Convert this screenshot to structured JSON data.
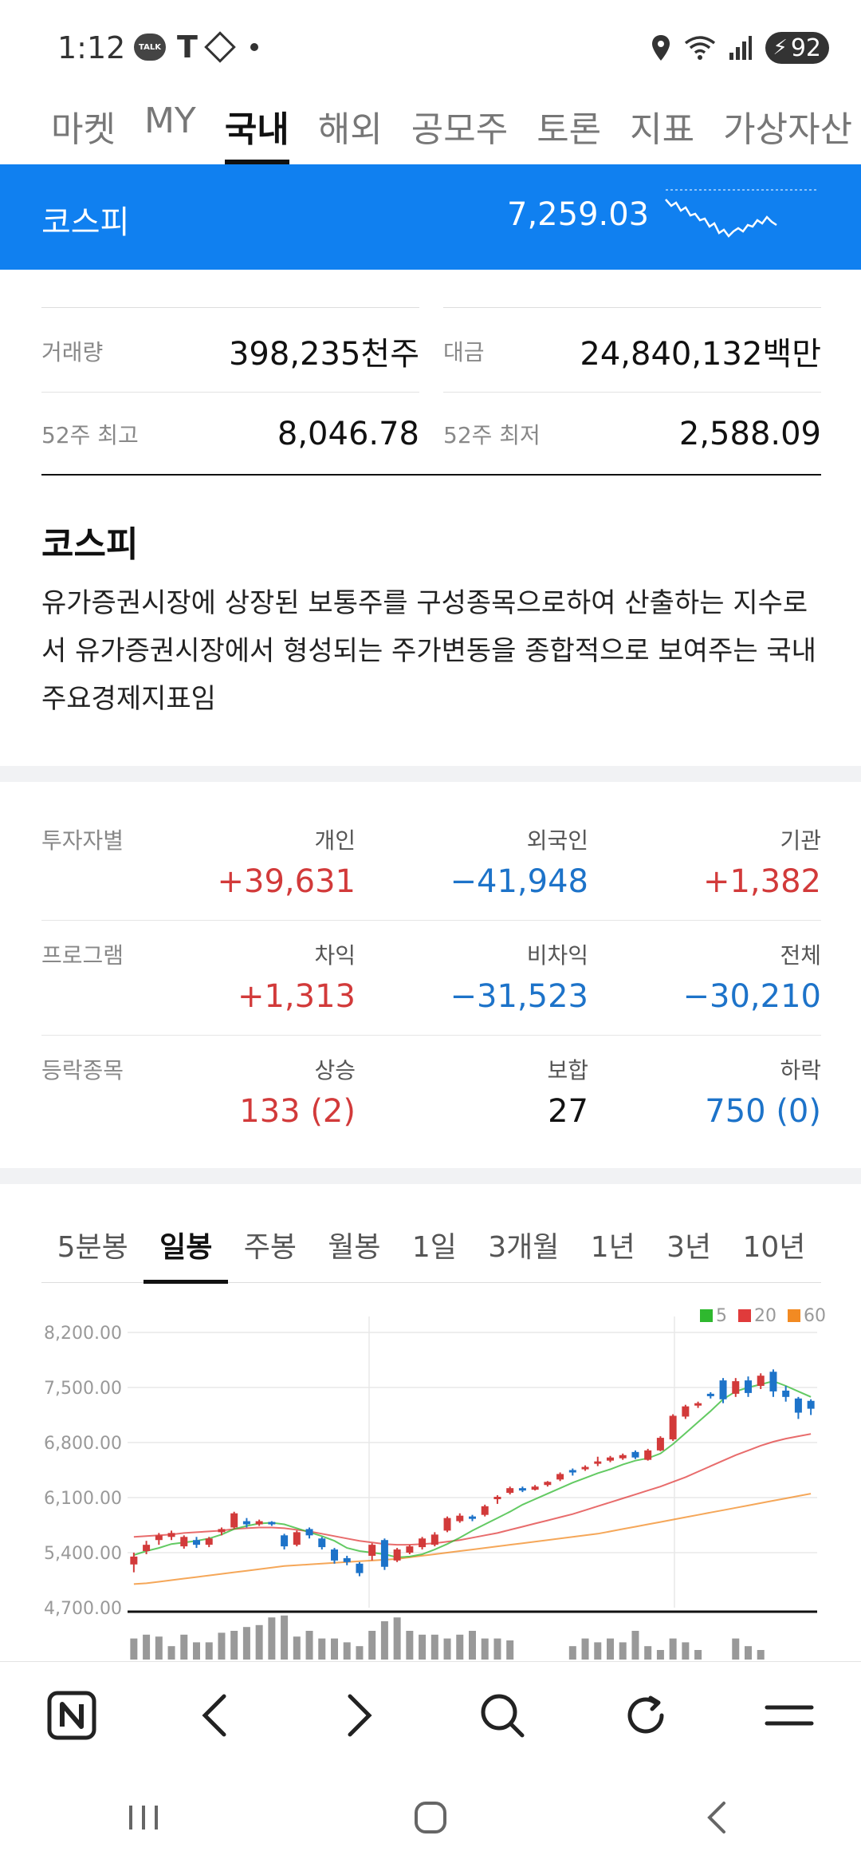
{
  "status_bar": {
    "time": "1:12",
    "battery": "92",
    "icons": [
      "kakaotalk-icon",
      "t-icon",
      "diamond-icon",
      "dot-icon",
      "location-icon",
      "wifi-icon",
      "signal-icon",
      "battery-icon"
    ]
  },
  "top_tabs": [
    {
      "label": "마켓",
      "active": false
    },
    {
      "label": "MY",
      "active": false
    },
    {
      "label": "국내",
      "active": true
    },
    {
      "label": "해외",
      "active": false
    },
    {
      "label": "공모주",
      "active": false
    },
    {
      "label": "토론",
      "active": false
    },
    {
      "label": "지표",
      "active": false
    },
    {
      "label": "가상자산",
      "active": false
    }
  ],
  "banner": {
    "name": "코스피",
    "value": "7,259.03",
    "color": "#1080f0"
  },
  "stats": {
    "volume_label": "거래량",
    "volume_value": "398,235천주",
    "amount_label": "대금",
    "amount_value": "24,840,132백만",
    "high52_label": "52주 최고",
    "high52_value": "8,046.78",
    "low52_label": "52주 최저",
    "low52_value": "2,588.09"
  },
  "description": {
    "title": "코스피",
    "text": "유가증권시장에 상장된 보통주를 구성종목으로하여 산출하는 지수로서 유가증권시장에서 형성되는 주가변동을 종합적으로 보여주는 국내 주요경제지표임"
  },
  "investors": {
    "label": "투자자별",
    "col1": {
      "header": "개인",
      "value": "+39,631"
    },
    "col2": {
      "header": "외국인",
      "value": "−41,948"
    },
    "col3": {
      "header": "기관",
      "value": "+1,382"
    }
  },
  "program": {
    "label": "프로그램",
    "col1": {
      "header": "차익",
      "value": "+1,313"
    },
    "col2": {
      "header": "비차익",
      "value": "−31,523"
    },
    "col3": {
      "header": "전체",
      "value": "−30,210"
    }
  },
  "breadth": {
    "label": "등락종목",
    "col1": {
      "header": "상승",
      "value": "133 (2)"
    },
    "col2": {
      "header": "보합",
      "value": "27"
    },
    "col3": {
      "header": "하락",
      "value": "750 (0)"
    }
  },
  "period_tabs": [
    {
      "label": "5분봉",
      "active": false
    },
    {
      "label": "일봉",
      "active": true
    },
    {
      "label": "주봉",
      "active": false
    },
    {
      "label": "월봉",
      "active": false
    },
    {
      "label": "1일",
      "active": false
    },
    {
      "label": "3개월",
      "active": false
    },
    {
      "label": "1년",
      "active": false
    },
    {
      "label": "3년",
      "active": false
    },
    {
      "label": "10년",
      "active": false
    }
  ],
  "colors": {
    "up": "#d23a3a",
    "down": "#1d73c9",
    "ma5": "#2fb82f",
    "ma20": "#e03b3b",
    "ma60": "#f28a22"
  },
  "chart_data": {
    "type": "candlestick",
    "y_ticks": [
      "8,200.00",
      "7,500.00",
      "6,800.00",
      "6,100.00",
      "5,400.00",
      "4,700.00"
    ],
    "ylim": [
      4700,
      8200
    ],
    "legend": [
      {
        "name": "5",
        "color": "#2fb82f"
      },
      {
        "name": "20",
        "color": "#e03b3b"
      },
      {
        "name": "60",
        "color": "#f28a22"
      }
    ],
    "candles": [
      [
        5250,
        5350,
        5150,
        5400
      ],
      [
        5420,
        5500,
        5380,
        5550
      ],
      [
        5560,
        5620,
        5500,
        5650
      ],
      [
        5600,
        5650,
        5560,
        5680
      ],
      [
        5480,
        5600,
        5450,
        5620
      ],
      [
        5560,
        5500,
        5460,
        5600
      ],
      [
        5500,
        5580,
        5470,
        5600
      ],
      [
        5660,
        5700,
        5620,
        5720
      ],
      [
        5720,
        5900,
        5700,
        5920
      ],
      [
        5800,
        5760,
        5720,
        5840
      ],
      [
        5760,
        5800,
        5740,
        5820
      ],
      [
        5790,
        5770,
        5740,
        5800
      ],
      [
        5620,
        5480,
        5440,
        5640
      ],
      [
        5500,
        5660,
        5480,
        5680
      ],
      [
        5700,
        5620,
        5580,
        5720
      ],
      [
        5580,
        5470,
        5440,
        5600
      ],
      [
        5440,
        5300,
        5260,
        5460
      ],
      [
        5330,
        5280,
        5240,
        5360
      ],
      [
        5260,
        5140,
        5100,
        5280
      ],
      [
        5360,
        5500,
        5300,
        5520
      ],
      [
        5560,
        5220,
        5180,
        5580
      ],
      [
        5300,
        5440,
        5280,
        5460
      ],
      [
        5400,
        5480,
        5380,
        5500
      ],
      [
        5470,
        5580,
        5440,
        5600
      ],
      [
        5500,
        5630,
        5480,
        5660
      ],
      [
        5680,
        5840,
        5660,
        5860
      ],
      [
        5800,
        5870,
        5780,
        5900
      ],
      [
        5860,
        5830,
        5800,
        5880
      ],
      [
        5880,
        5990,
        5860,
        6010
      ],
      [
        6080,
        6110,
        6020,
        6130
      ],
      [
        6160,
        6220,
        6140,
        6240
      ],
      [
        6220,
        6200,
        6170,
        6240
      ],
      [
        6200,
        6240,
        6190,
        6260
      ],
      [
        6260,
        6300,
        6240,
        6310
      ],
      [
        6330,
        6400,
        6310,
        6420
      ],
      [
        6450,
        6420,
        6380,
        6470
      ],
      [
        6480,
        6490,
        6440,
        6510
      ],
      [
        6560,
        6560,
        6500,
        6620
      ],
      [
        6570,
        6610,
        6550,
        6630
      ],
      [
        6600,
        6640,
        6580,
        6660
      ],
      [
        6680,
        6610,
        6590,
        6700
      ],
      [
        6580,
        6700,
        6570,
        6720
      ],
      [
        6700,
        6860,
        6690,
        6880
      ],
      [
        6840,
        7140,
        6820,
        7160
      ],
      [
        7130,
        7260,
        7100,
        7280
      ],
      [
        7280,
        7300,
        7240,
        7320
      ],
      [
        7420,
        7400,
        7360,
        7440
      ],
      [
        7590,
        7350,
        7300,
        7620
      ],
      [
        7420,
        7580,
        7380,
        7620
      ],
      [
        7590,
        7430,
        7380,
        7640
      ],
      [
        7520,
        7650,
        7480,
        7680
      ],
      [
        7700,
        7450,
        7380,
        7730
      ],
      [
        7460,
        7380,
        7320,
        7520
      ],
      [
        7360,
        7180,
        7100,
        7380
      ],
      [
        7330,
        7230,
        7150,
        7350
      ]
    ],
    "ma5": [
      5370,
      5420,
      5460,
      5510,
      5530,
      5550,
      5580,
      5630,
      5700,
      5740,
      5770,
      5780,
      5760,
      5710,
      5660,
      5610,
      5550,
      5460,
      5420,
      5400,
      5380,
      5340,
      5350,
      5380,
      5440,
      5510,
      5590,
      5680,
      5760,
      5840,
      5920,
      6010,
      6080,
      6150,
      6220,
      6290,
      6350,
      6410,
      6460,
      6520,
      6570,
      6600,
      6660,
      6780,
      6920,
      7060,
      7200,
      7350,
      7450,
      7500,
      7540,
      7580,
      7520,
      7450,
      7380
    ],
    "ma20": [
      5600,
      5610,
      5620,
      5630,
      5650,
      5660,
      5670,
      5680,
      5700,
      5710,
      5720,
      5720,
      5710,
      5690,
      5670,
      5640,
      5610,
      5580,
      5550,
      5530,
      5510,
      5500,
      5500,
      5510,
      5520,
      5540,
      5560,
      5590,
      5620,
      5650,
      5690,
      5730,
      5770,
      5810,
      5850,
      5890,
      5940,
      5990,
      6040,
      6090,
      6140,
      6190,
      6240,
      6300,
      6360,
      6430,
      6500,
      6570,
      6640,
      6700,
      6760,
      6810,
      6850,
      6880,
      6910
    ],
    "ma60": [
      5000,
      5010,
      5030,
      5050,
      5070,
      5090,
      5110,
      5130,
      5150,
      5170,
      5190,
      5210,
      5230,
      5240,
      5250,
      5260,
      5270,
      5280,
      5290,
      5300,
      5310,
      5320,
      5340,
      5360,
      5380,
      5400,
      5420,
      5440,
      5460,
      5480,
      5500,
      5520,
      5540,
      5560,
      5580,
      5600,
      5620,
      5640,
      5670,
      5700,
      5730,
      5760,
      5790,
      5820,
      5850,
      5880,
      5910,
      5940,
      5970,
      6000,
      6030,
      6060,
      6090,
      6120,
      6150
    ],
    "volume": [
      22,
      26,
      24,
      14,
      26,
      18,
      18,
      28,
      30,
      34,
      36,
      44,
      46,
      24,
      30,
      22,
      22,
      18,
      14,
      30,
      40,
      44,
      30,
      26,
      26,
      22,
      26,
      30,
      22,
      22,
      20,
      0,
      0,
      0,
      0,
      14,
      22,
      18,
      22,
      18,
      30,
      14,
      10,
      22,
      18,
      10,
      0,
      0,
      22,
      14,
      10,
      0,
      0,
      0,
      0
    ]
  },
  "browser_nav": {
    "icons": [
      "naver-home-icon",
      "back-icon",
      "forward-icon",
      "search-icon",
      "refresh-icon",
      "menu-icon"
    ]
  },
  "system_nav": {
    "icons": [
      "recent-apps-icon",
      "home-icon",
      "system-back-icon"
    ]
  }
}
